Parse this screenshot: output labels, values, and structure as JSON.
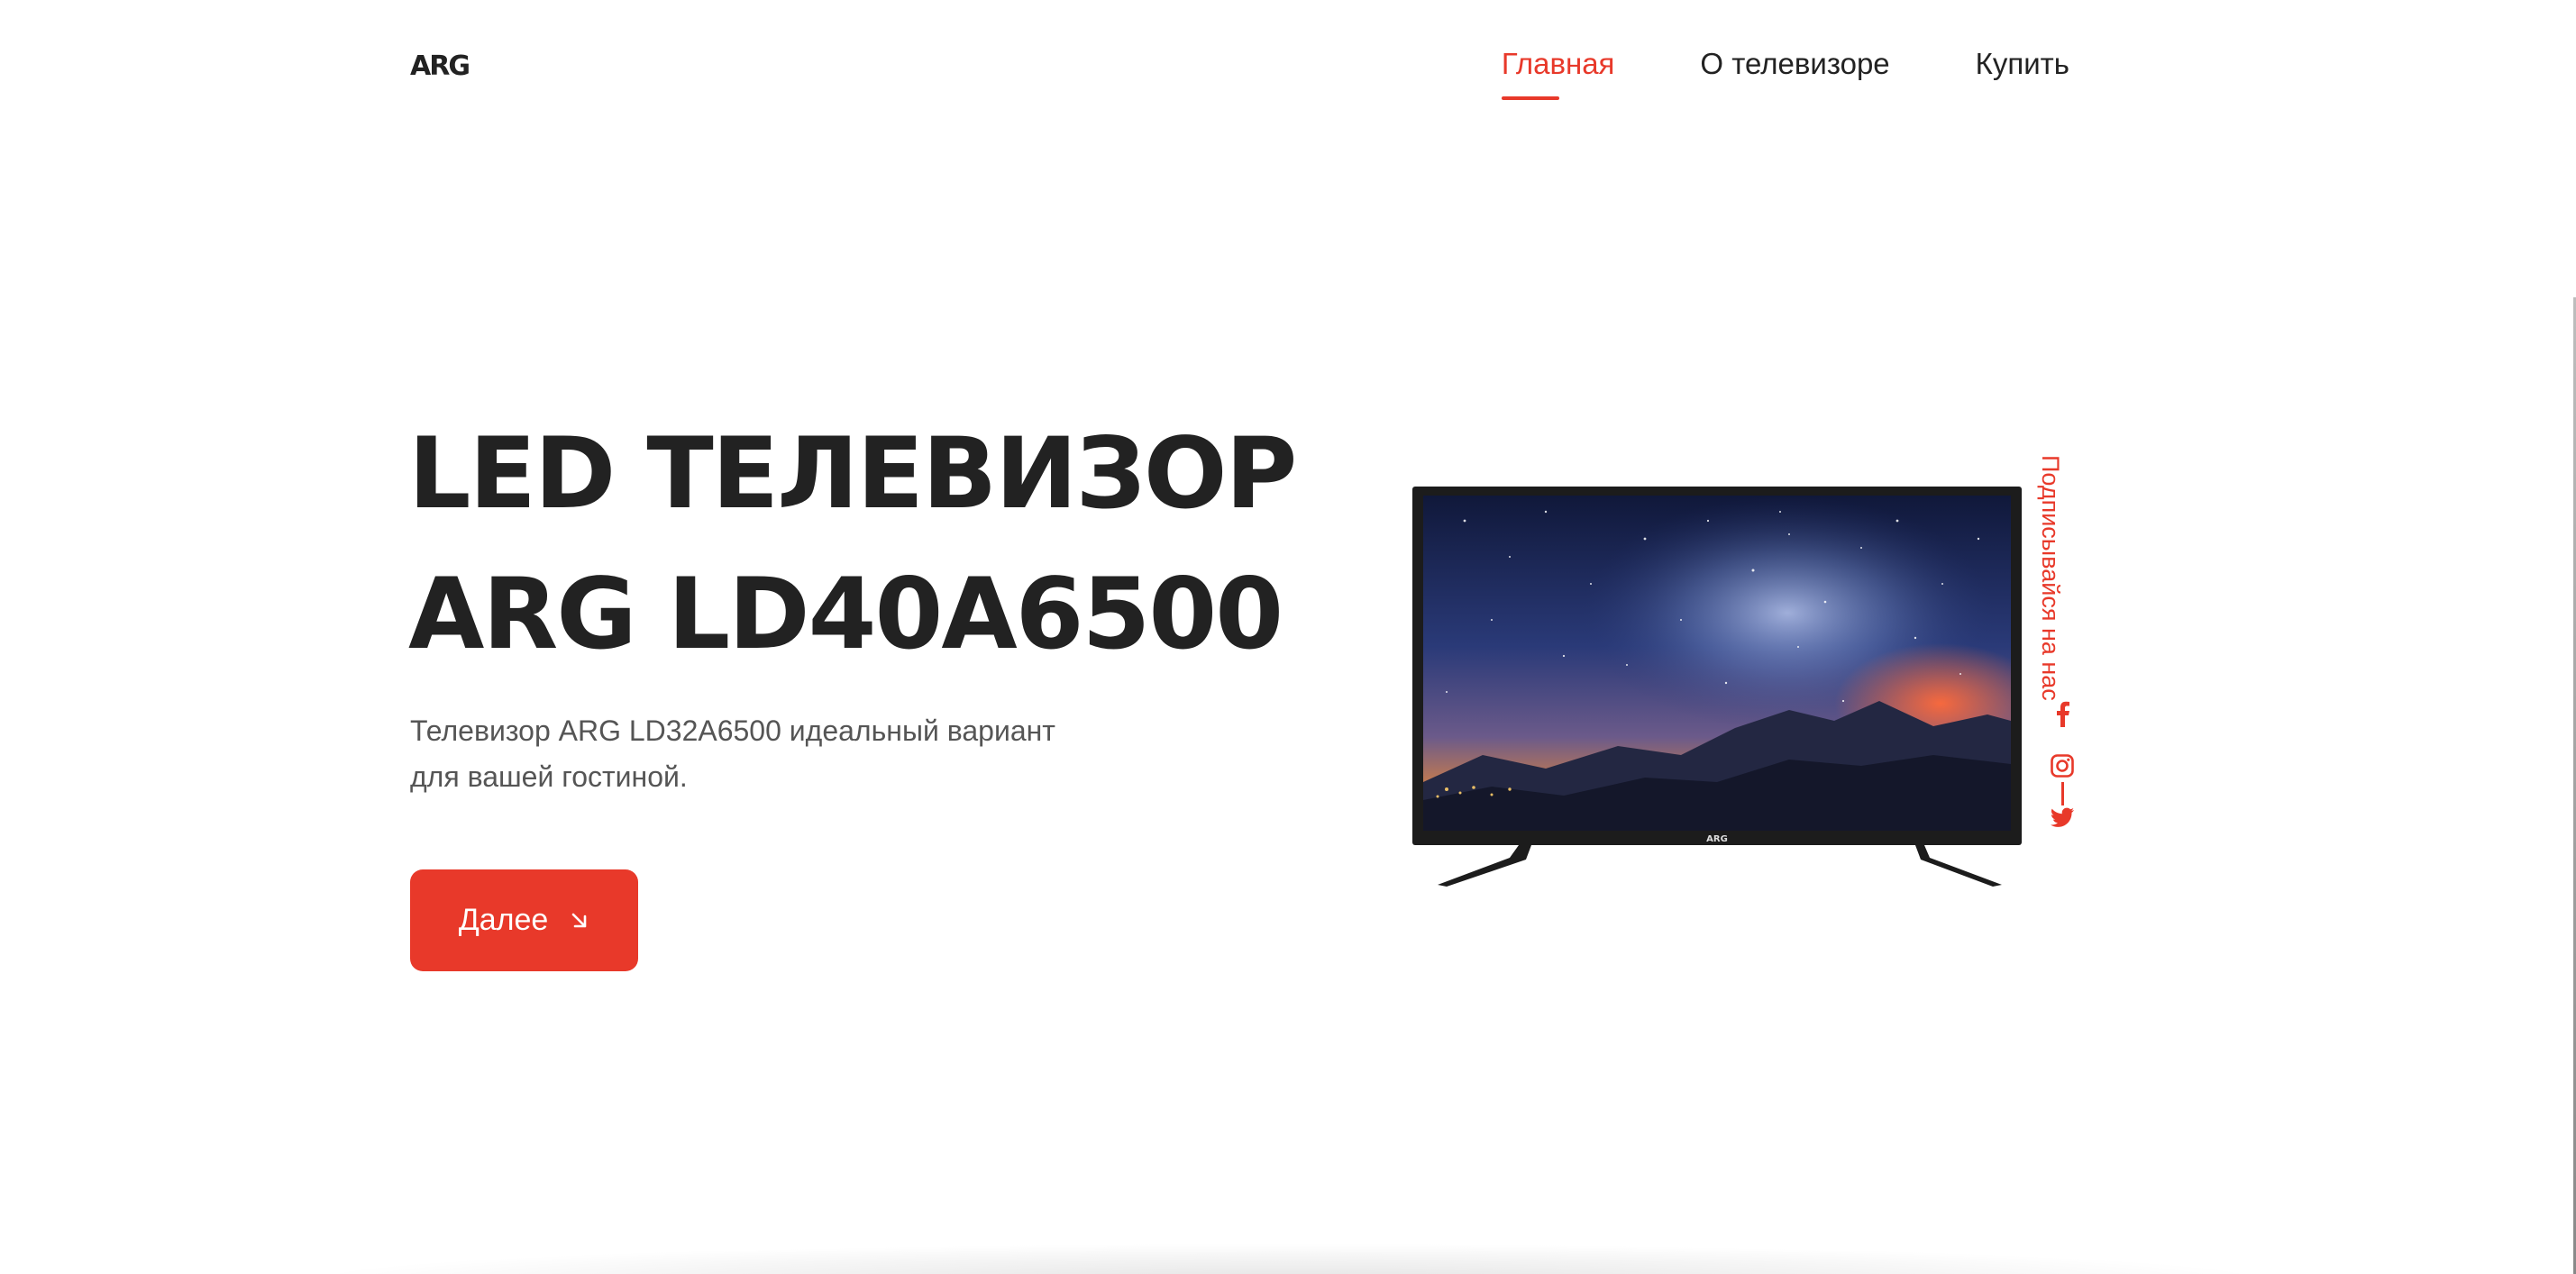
{
  "header": {
    "logo": "ARG",
    "nav": [
      {
        "label": "Главная",
        "active": true
      },
      {
        "label": "О телевизоре",
        "active": false
      },
      {
        "label": "Купить",
        "active": false
      }
    ]
  },
  "hero": {
    "title_line1": "LED ТЕЛЕВИЗОР",
    "title_line2": "ARG LD40A6500",
    "description": "Телевизор ARG LD32A6500 идеальный вариант для вашей гостиной.",
    "cta_label": "Далее",
    "tv_brand": "ARG"
  },
  "social": {
    "label": "Подписывайся на нас",
    "icons": [
      "facebook-icon",
      "instagram-icon",
      "twitter-icon"
    ]
  },
  "colors": {
    "accent": "#e8392a",
    "text": "#222222",
    "muted": "#555555"
  }
}
